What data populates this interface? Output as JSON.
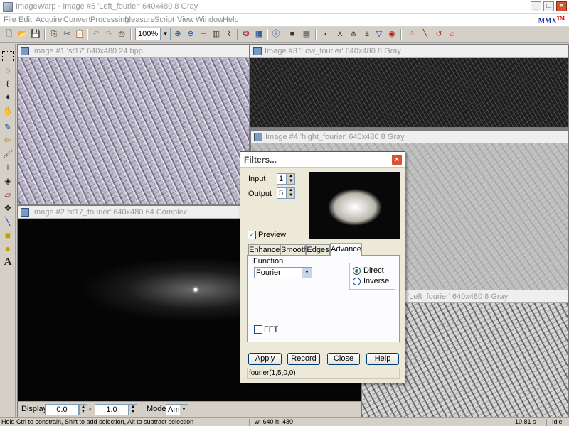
{
  "app": {
    "title": "ImageWarp - Image #5 'Left_fourier'  640x480  8 Gray",
    "logo": "MMX",
    "logo_mark": "TM"
  },
  "window_buttons": {
    "minimize": "_",
    "maximize": "□",
    "close": "×"
  },
  "menu": [
    "File",
    "Edit",
    "Acquire",
    "Convert",
    "Processing",
    "Measure",
    "Script",
    "View",
    "Window",
    "Help"
  ],
  "toolbar": {
    "zoom": "100%",
    "icons": [
      "new-file-icon",
      "open-folder-icon",
      "save-icon",
      "copy-icon",
      "cut-icon",
      "paste-icon",
      "undo-icon",
      "redo-icon",
      "print-icon",
      "zoom-in-icon",
      "zoom-out-icon",
      "rulers-icon",
      "histogram-icon",
      "profile-icon",
      "color-wheel-icon",
      "grid-icon",
      "info-icon",
      "video-icon",
      "notes-icon",
      "contrast-icon",
      "filter-icon",
      "fourier-icon",
      "plus-minus-icon",
      "funnel-icon",
      "target-icon",
      "points-icon",
      "line-measure-icon",
      "angle-icon",
      "polygon-measure-icon"
    ]
  },
  "tools": [
    "rectangle-select",
    "ellipse-select",
    "lasso",
    "magic-wand",
    "hand",
    "eyedropper",
    "pencil",
    "brush",
    "stamp",
    "fill",
    "eraser",
    "clone",
    "line",
    "rectangle",
    "ellipse",
    "text"
  ],
  "documents": [
    {
      "title": "Image #1  'st17'  640x480  24  bpp"
    },
    {
      "title": "Image #2  'st17_fourier'  640x480  64 Complex"
    },
    {
      "title": "Image #3  'Low_fourier'  640x480  8 Gray"
    },
    {
      "title": "Image #4  'hight_fourier'  640x480  8 Gray"
    },
    {
      "title": "'Left_fourier'  640x480  8 Gray"
    }
  ],
  "display_bar": {
    "display_label": "Display:",
    "min_value": "0.0",
    "dash": "-",
    "max_value": "1.0",
    "mode_label": "Mode:",
    "mode_value": "Amp"
  },
  "filters": {
    "title": "Filters...",
    "input_label": "Input",
    "input_value": "1",
    "output_label": "Output",
    "output_value": "5",
    "preview_label": "Preview",
    "preview_checked": true,
    "tabs": [
      "Enhance",
      "Smooth",
      "Edges",
      "Advance"
    ],
    "active_tab": "Advance",
    "function_label": "Function",
    "function_value": "Fourier",
    "direction": {
      "direct": "Direct",
      "inverse": "Inverse",
      "selected": "Direct"
    },
    "fft_label": "FFT",
    "fft_checked": false,
    "buttons": {
      "apply": "Apply",
      "record": "Record",
      "close": "Close",
      "help": "Help"
    },
    "status": "fourier(1,5,0,0)"
  },
  "status_bar": {
    "hint": "Hold Ctrl to constrain, Shift to add selection, Alt to subtract selection",
    "size": "w: 640  h: 480",
    "time": "10.81 s",
    "state": "Idle"
  }
}
